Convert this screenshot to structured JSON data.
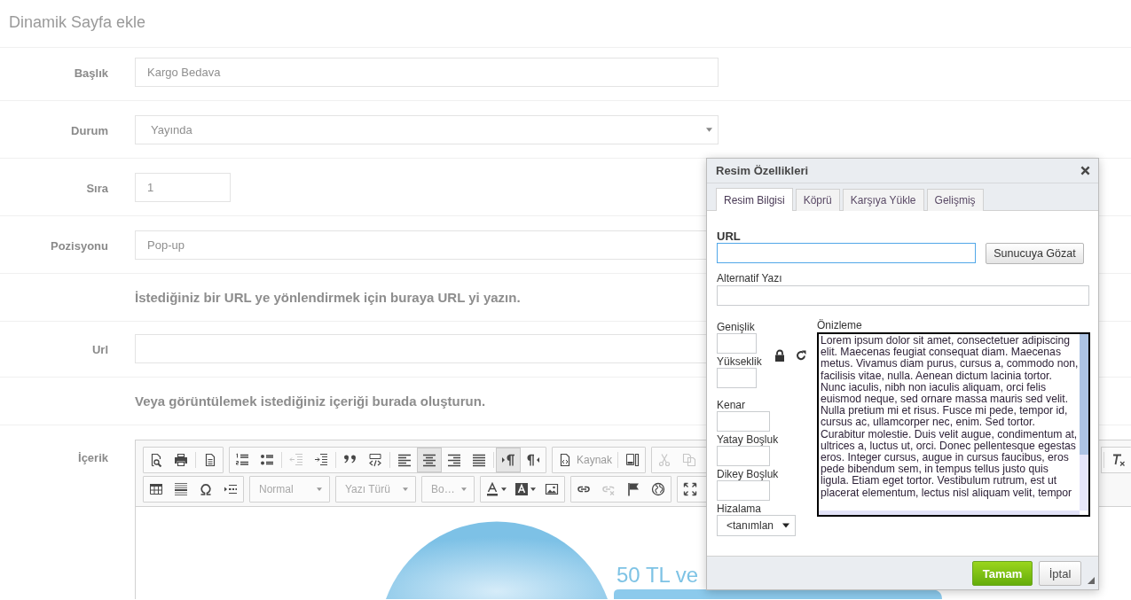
{
  "page": {
    "title": "Dinamik Sayfa ekle"
  },
  "form": [
    {
      "kind": "input",
      "label": "Başlık",
      "value": "Kargo Bedava"
    },
    {
      "kind": "select",
      "label": "Durum",
      "value": "Yayında"
    },
    {
      "kind": "short",
      "label": "Sıra",
      "value": "1"
    },
    {
      "kind": "input",
      "label": "Pozisyonu",
      "value": "Pop-up"
    },
    {
      "kind": "hint",
      "text": "İstediğiniz bir URL ye yönlendirmek için buraya URL yi yazın."
    },
    {
      "kind": "input",
      "label": "Url"
    },
    {
      "kind": "hint",
      "text": "Veya görüntülemek istediğiniz içeriği burada oluşturun."
    },
    {
      "kind": "editor",
      "label": "İçerik"
    }
  ],
  "editor": {
    "toolbar": [
      [
        {
          "kind": "group",
          "items": [
            {
              "kind": "icon",
              "pressed": false,
              "disabled": false
            },
            {
              "kind": "icon",
              "pressed": false,
              "disabled": false
            },
            {
              "kind": "separator"
            },
            {
              "kind": "icon",
              "pressed": false,
              "disabled": false
            }
          ]
        },
        {
          "kind": "group",
          "items": [
            {
              "kind": "icon",
              "pressed": false,
              "disabled": false
            },
            {
              "kind": "icon",
              "pressed": false,
              "disabled": false
            },
            {
              "kind": "separator"
            },
            {
              "kind": "icon",
              "pressed": false,
              "disabled": true
            },
            {
              "kind": "icon",
              "pressed": false,
              "disabled": false
            },
            {
              "kind": "separator"
            },
            {
              "kind": "icon",
              "pressed": false,
              "disabled": false
            },
            {
              "kind": "icon",
              "pressed": false,
              "disabled": false
            },
            {
              "kind": "separator"
            },
            {
              "kind": "icon",
              "pressed": false,
              "disabled": false
            },
            {
              "kind": "icon",
              "pressed": true,
              "disabled": false
            },
            {
              "kind": "icon",
              "pressed": false,
              "disabled": false
            },
            {
              "kind": "icon",
              "pressed": false,
              "disabled": false
            },
            {
              "kind": "separator"
            },
            {
              "kind": "icon",
              "pressed": true,
              "disabled": false
            },
            {
              "kind": "icon",
              "pressed": false,
              "disabled": false
            }
          ]
        },
        {
          "kind": "group",
          "items": [
            {
              "kind": "label",
              "label": "Kaynak",
              "pressed": false,
              "disabled": false
            },
            {
              "kind": "separator"
            },
            {
              "kind": "icon",
              "pressed": false,
              "disabled": false
            }
          ]
        },
        {
          "kind": "group",
          "items": [
            {
              "kind": "icon",
              "pressed": false,
              "disabled": true
            },
            {
              "kind": "icon",
              "pressed": false,
              "disabled": true
            }
          ]
        },
        {
          "kind": "group",
          "items": [
            {
              "kind": "separator"
            },
            {
              "kind": "icon",
              "pressed": false,
              "disabled": false
            }
          ]
        }
      ],
      [
        {
          "kind": "group",
          "items": [
            {
              "kind": "icon",
              "pressed": false,
              "disabled": false
            },
            {
              "kind": "icon",
              "pressed": false,
              "disabled": false
            },
            {
              "kind": "icon",
              "pressed": false,
              "disabled": false
            },
            {
              "kind": "icon",
              "pressed": false,
              "disabled": false
            }
          ]
        },
        {
          "kind": "combo",
          "label": "Normal"
        },
        {
          "kind": "combo",
          "label": "Yazı Türü"
        },
        {
          "kind": "combo",
          "label": "Bo…"
        },
        {
          "kind": "group",
          "items": [
            {
              "kind": "menu",
              "pressed": false,
              "disabled": false
            },
            {
              "kind": "menu",
              "pressed": false,
              "disabled": false
            },
            {
              "kind": "icon",
              "pressed": false,
              "disabled": false
            }
          ]
        },
        {
          "kind": "group",
          "items": [
            {
              "kind": "icon",
              "pressed": false,
              "disabled": false
            },
            {
              "kind": "icon",
              "pressed": false,
              "disabled": true
            },
            {
              "kind": "icon",
              "pressed": false,
              "disabled": false
            },
            {
              "kind": "icon",
              "pressed": false,
              "disabled": false
            }
          ]
        },
        {
          "kind": "group",
          "items": [
            {
              "kind": "icon",
              "pressed": false,
              "disabled": false
            }
          ]
        }
      ]
    ],
    "content": {
      "banner_text": "50 TL ve"
    }
  },
  "dialog": {
    "title": "Resim Özellikleri",
    "tabs": [
      {
        "label": "Resim Bilgisi",
        "selected": true
      },
      {
        "label": "Köprü",
        "selected": false
      },
      {
        "label": "Karşıya Yükle",
        "selected": false
      },
      {
        "label": "Gelişmiş",
        "selected": false
      }
    ],
    "url": {
      "label": "URL",
      "focused": true
    },
    "browse_button": "Sunucuya Gözat",
    "alt_text": {
      "label": "Alternatif Yazı"
    },
    "size_fields": [
      {
        "label": "Genişlik"
      },
      {
        "label": "Yükseklik"
      }
    ],
    "ratio_locked": true,
    "spacing_fields": [
      {
        "label": "Kenar"
      },
      {
        "label": "Yatay Boşluk"
      },
      {
        "label": "Dikey Boşluk"
      }
    ],
    "align": {
      "label": "Hizalama",
      "value": "<tanımlan"
    },
    "preview": {
      "label": "Önizleme",
      "text": "Lorem ipsum dolor sit amet, consectetuer adipiscing elit. Maecenas feugiat consequat diam. Maecenas metus. Vivamus diam purus, cursus a, commodo non, facilisis vitae, nulla. Aenean dictum lacinia tortor. Nunc iaculis, nibh non iaculis aliquam, orci felis euismod neque, sed ornare massa mauris sed velit. Nulla pretium mi et risus. Fusce mi pede, tempor id, cursus ac, ullamcorper nec, enim. Sed tortor. Curabitur molestie. Duis velit augue, condimentum at, ultrices a, luctus ut, orci. Donec pellentesque egestas eros. Integer cursus, augue in cursus faucibus, eros pede bibendum sem, in tempus tellus justo quis ligula. Etiam eget tortor. Vestibulum rutrum, est ut placerat elementum, lectus nisl aliquam velit, tempor"
    },
    "buttons": [
      {
        "label": "Tamam",
        "kind": "primary"
      },
      {
        "label": "İptal",
        "kind": "secondary"
      }
    ]
  }
}
